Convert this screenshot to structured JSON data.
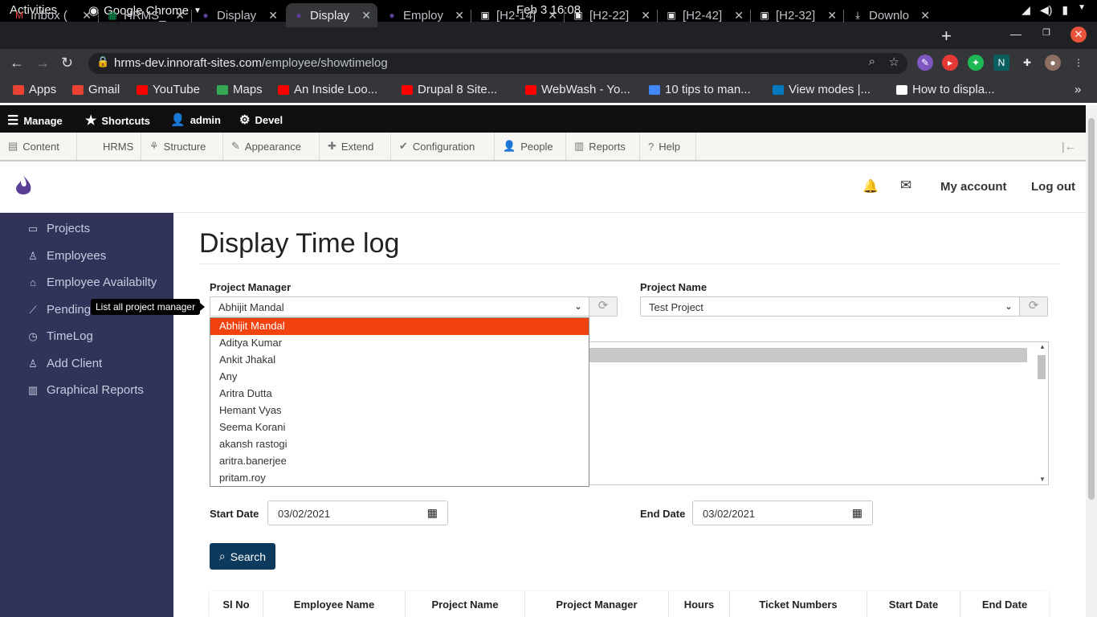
{
  "system": {
    "activities": "Activities",
    "app": "Google Chrome",
    "clock": "Feb 3  16:08"
  },
  "tabs": [
    {
      "title": "Inbox (",
      "icon": "gmail-icon",
      "color": "#ea4335"
    },
    {
      "title": "HRMS_",
      "icon": "sheets-icon",
      "color": "#0f9d58"
    },
    {
      "title": "Display",
      "icon": "drupal-icon",
      "color": "#5b3e96"
    },
    {
      "title": "Display",
      "icon": "drupal-icon",
      "color": "#5b3e96"
    },
    {
      "title": "Employ",
      "icon": "drupal-icon",
      "color": "#5b3e96"
    },
    {
      "title": "[H2-14]",
      "icon": "jira-icon",
      "color": "#e8eaed"
    },
    {
      "title": "[H2-22]",
      "icon": "jira-icon",
      "color": "#e8eaed"
    },
    {
      "title": "[H2-42]",
      "icon": "jira-icon",
      "color": "#e8eaed"
    },
    {
      "title": "[H2-32]",
      "icon": "jira-icon",
      "color": "#e8eaed"
    },
    {
      "title": "Downlo",
      "icon": "download-icon",
      "color": "#e8eaed"
    }
  ],
  "address": {
    "host": "hrms-dev.innoraft-sites.com",
    "path": "/employee/showtimelog"
  },
  "bookmarks": [
    {
      "label": "Apps",
      "color": "#ea4335"
    },
    {
      "label": "Gmail",
      "color": "#ea4335"
    },
    {
      "label": "YouTube",
      "color": "#ff0000"
    },
    {
      "label": "Maps",
      "color": "#34a853"
    },
    {
      "label": "An Inside Loo...",
      "color": "#ff0000"
    },
    {
      "label": "Drupal 8 Site...",
      "color": "#ff0000"
    },
    {
      "label": "WebWash - Yo...",
      "color": "#ff0000"
    },
    {
      "label": "10 tips to man...",
      "color": "#4285f4"
    },
    {
      "label": "View modes |...",
      "color": "#0678be"
    },
    {
      "label": "How to displa...",
      "color": "#ffffff"
    }
  ],
  "admin_toolbar": {
    "manage": "Manage",
    "shortcuts": "Shortcuts",
    "user": "admin",
    "devel": "Devel"
  },
  "admin_tray": [
    "Content",
    "HRMS",
    "Structure",
    "Appearance",
    "Extend",
    "Configuration",
    "People",
    "Reports",
    "Help"
  ],
  "header": {
    "my_account": "My account",
    "logout": "Log out"
  },
  "sidebar": [
    {
      "label": "Projects",
      "icon": "projects-icon"
    },
    {
      "label": "Employees",
      "icon": "employees-icon"
    },
    {
      "label": "Employee Availabilty",
      "icon": "availability-icon"
    },
    {
      "label": "Pending",
      "icon": "pending-icon"
    },
    {
      "label": "TimeLog",
      "icon": "timelog-icon"
    },
    {
      "label": "Add Client",
      "icon": "add-client-icon"
    },
    {
      "label": "Graphical Reports",
      "icon": "graphical-reports-icon"
    }
  ],
  "tooltip": "List all project manager",
  "page": {
    "title": "Display Time log",
    "project_manager_label": "Project Manager",
    "project_manager_value": "Abhijit Mandal",
    "project_name_label": "Project Name",
    "project_name_value": "Test Project",
    "manager_options": [
      "Abhijit Mandal",
      "Aditya Kumar",
      "Ankit Jhakal",
      "Any",
      "Aritra Dutta",
      "Hemant Vyas",
      "Seema Korani",
      "akansh rastogi",
      "aritra.banerjee",
      "pritam.roy"
    ],
    "start_date_label": "Start Date",
    "start_date_value": "03/02/2021",
    "end_date_label": "End Date",
    "end_date_value": "03/02/2021",
    "search_label": "Search",
    "table_headers": [
      "Sl No",
      "Employee Name",
      "Project Name",
      "Project Manager",
      "Hours",
      "Ticket Numbers",
      "Start Date",
      "End Date"
    ]
  }
}
